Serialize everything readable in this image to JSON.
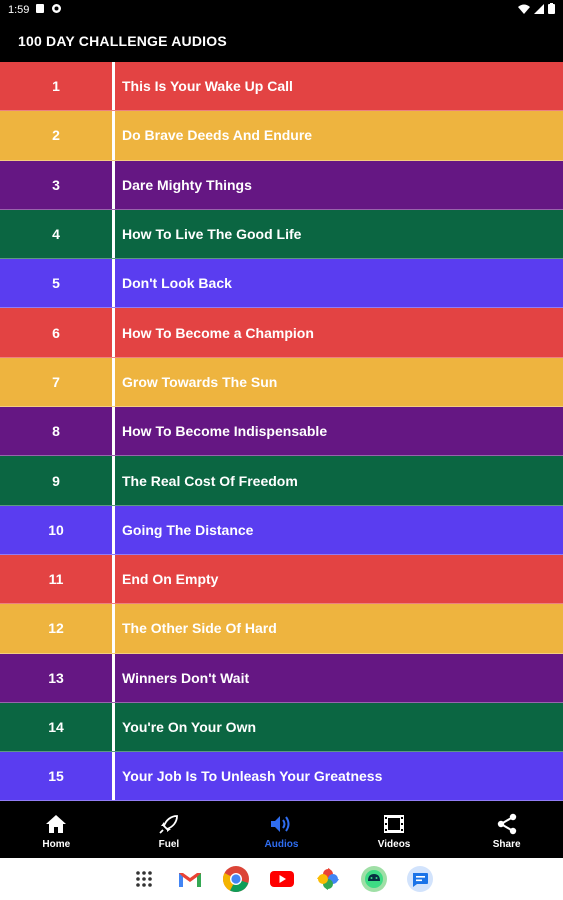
{
  "status_bar": {
    "time": "1:59"
  },
  "app_bar": {
    "title": "100 DAY CHALLENGE AUDIOS"
  },
  "colors": {
    "red": "#e34343",
    "yellow": "#eeb43f",
    "purple": "#651783",
    "green": "#0b6642",
    "blue": "#5a3df0"
  },
  "audios": [
    {
      "num": "1",
      "title": "This Is Your Wake Up Call",
      "color": "#e34343"
    },
    {
      "num": "2",
      "title": "Do Brave Deeds And Endure",
      "color": "#eeb43f"
    },
    {
      "num": "3",
      "title": "Dare Mighty Things",
      "color": "#651783"
    },
    {
      "num": "4",
      "title": "How To Live The Good Life",
      "color": "#0b6642"
    },
    {
      "num": "5",
      "title": "Don't Look Back",
      "color": "#5a3df0"
    },
    {
      "num": "6",
      "title": "How To Become a Champion",
      "color": "#e34343"
    },
    {
      "num": "7",
      "title": "Grow Towards The Sun",
      "color": "#eeb43f"
    },
    {
      "num": "8",
      "title": "How To Become Indispensable",
      "color": "#651783"
    },
    {
      "num": "9",
      "title": "The Real Cost Of Freedom",
      "color": "#0b6642"
    },
    {
      "num": "10",
      "title": "Going The Distance",
      "color": "#5a3df0"
    },
    {
      "num": "11",
      "title": "End On Empty",
      "color": "#e34343"
    },
    {
      "num": "12",
      "title": "The Other Side Of Hard",
      "color": "#eeb43f"
    },
    {
      "num": "13",
      "title": "Winners Don't Wait",
      "color": "#651783"
    },
    {
      "num": "14",
      "title": "You're On Your Own",
      "color": "#0b6642"
    },
    {
      "num": "15",
      "title": "Your Job Is To Unleash Your Greatness",
      "color": "#5a3df0"
    }
  ],
  "bottom_nav": [
    {
      "label": "Home",
      "icon": "home-icon",
      "active": false
    },
    {
      "label": "Fuel",
      "icon": "rocket-icon",
      "active": false
    },
    {
      "label": "Audios",
      "icon": "speaker-icon",
      "active": true
    },
    {
      "label": "Videos",
      "icon": "film-icon",
      "active": false
    },
    {
      "label": "Share",
      "icon": "share-icon",
      "active": false
    }
  ],
  "dock": [
    "apps-grid-icon",
    "gmail-icon",
    "chrome-icon",
    "youtube-icon",
    "photos-icon",
    "android-icon",
    "messages-icon"
  ]
}
